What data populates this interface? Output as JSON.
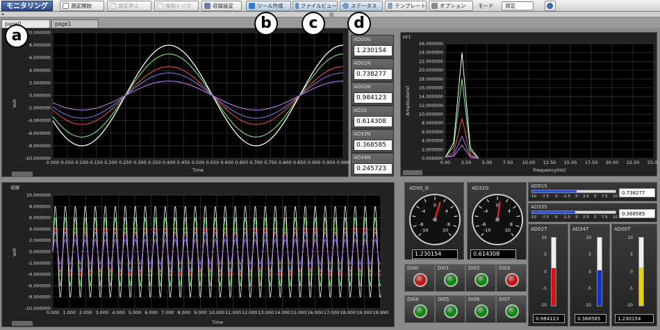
{
  "toolbar": {
    "title": "モニタリング",
    "buttons": [
      {
        "label": "測定開始",
        "icon": "play-icon",
        "enabled": true
      },
      {
        "label": "測定停止",
        "icon": "stop-icon",
        "enabled": false
      },
      {
        "label": "強制トリガ",
        "icon": "trigger-icon",
        "enabled": false
      },
      {
        "label": "収録設定",
        "icon": "settings-icon",
        "enabled": true
      },
      {
        "label": "ツール作成",
        "icon": "plus-icon",
        "enabled": true
      },
      {
        "label": "ファイルビュー",
        "icon": "file-icon",
        "enabled": true
      },
      {
        "label": "ステータス",
        "icon": "search-icon",
        "enabled": true
      },
      {
        "label": "テンプレート",
        "icon": "template-icon",
        "enabled": true
      },
      {
        "label": "オプション",
        "icon": "wrench-icon",
        "enabled": true
      }
    ],
    "mode_label": "モード",
    "mode_value": "測定"
  },
  "tabs": [
    {
      "label": "page0",
      "active": true
    },
    {
      "label": "page1",
      "active": false
    }
  ],
  "callouts": [
    "a",
    "b",
    "c",
    "d"
  ],
  "wave_chart": {
    "ylabel": "Volt",
    "xlabel": "Time",
    "yticks": [
      "10.000000",
      "8.000000",
      "6.000000",
      "4.000000",
      "2.000000",
      "0.000000",
      "-2.000000",
      "-4.000000",
      "-6.000000",
      "-8.000000",
      "-10.000000"
    ],
    "xticks": [
      "0.000",
      "0.050",
      "0.100",
      "0.150",
      "0.200",
      "0.250",
      "0.300",
      "0.350",
      "0.400",
      "0.450",
      "0.500",
      "0.550",
      "0.600",
      "0.650",
      "0.700",
      "0.750",
      "0.800",
      "0.850",
      "0.900",
      "0.950",
      "0.999"
    ]
  },
  "channels": [
    {
      "name": "AD00N",
      "value": "1.230154"
    },
    {
      "name": "AD01N",
      "value": "0.738277"
    },
    {
      "name": "AD02N",
      "value": "0.984123"
    },
    {
      "name": "AD32",
      "value": "0.614308"
    },
    {
      "name": "AD33N",
      "value": "0.368585"
    },
    {
      "name": "AD34N",
      "value": "0.245723"
    }
  ],
  "fft_chart": {
    "title": "FFT",
    "ylabel": "Amplitude(V)",
    "xlabel": "Frequency(Hz)",
    "yticks": [
      "26.000000",
      "24.000000",
      "22.000000",
      "20.000000",
      "18.000000",
      "16.000000",
      "14.000000",
      "12.000000",
      "10.000000",
      "8.000000",
      "6.000000",
      "4.000000",
      "2.000000",
      "0.000000"
    ],
    "xticks": [
      "0.00",
      "2.50",
      "5.00",
      "7.50",
      "10.00",
      "12.50",
      "15.00",
      "17.50",
      "20.00",
      "22.50",
      "25.00"
    ]
  },
  "record_chart": {
    "title": "収録",
    "ylabel": "Volt",
    "xlabel": "Time",
    "yticks": [
      "10.000000",
      "8.000000",
      "6.000000",
      "4.000000",
      "2.000000",
      "0.000000",
      "-2.000000",
      "-4.000000",
      "-6.000000",
      "-8.000000",
      "-10.000000"
    ],
    "xticks": [
      "0.000",
      "1.000",
      "2.000",
      "3.000",
      "4.000",
      "5.000",
      "6.000",
      "7.000",
      "8.000",
      "9.000",
      "10.000",
      "11.000",
      "12.000",
      "13.000",
      "14.000",
      "15.000",
      "16.000",
      "17.000",
      "18.000",
      "19.000",
      "19.990"
    ]
  },
  "gauges": [
    {
      "name": "AD00_G",
      "value": "1.230154",
      "level": 1.230154
    },
    {
      "name": "AD32G",
      "value": "0.614308",
      "level": 0.614308
    }
  ],
  "gauge_scale": [
    "-10",
    "-8",
    "-6",
    "-4",
    "-2",
    "0",
    "2",
    "4",
    "6",
    "8",
    "10"
  ],
  "hbars": [
    {
      "name": "AD01S",
      "value": "0.738277",
      "level": 0.738277
    },
    {
      "name": "AD33S",
      "value": "0.368585",
      "level": 0.368585
    }
  ],
  "hbar_scale": [
    "-10",
    "-7.5",
    "-5",
    "-2.5",
    "0",
    "2.5",
    "5",
    "7.5",
    "10"
  ],
  "dio": [
    {
      "name": "DI00",
      "color": "#c81010"
    },
    {
      "name": "DI01",
      "color": "#0a8a0a"
    },
    {
      "name": "DI02",
      "color": "#0a8a0a"
    },
    {
      "name": "DI03",
      "color": "#c81010"
    },
    {
      "name": "DI04",
      "color": "#0a8a0a"
    },
    {
      "name": "DI05",
      "color": "#0a8a0a"
    },
    {
      "name": "DI06",
      "color": "#0a8a0a"
    },
    {
      "name": "DI07",
      "color": "#0a8a0a"
    }
  ],
  "thermometers": [
    {
      "name": "AD02T",
      "value": "0.984123",
      "level": 0.984123,
      "color": "#e01010"
    },
    {
      "name": "AD34T",
      "value": "0.368585",
      "level": 0.368585,
      "color": "#1030d0"
    },
    {
      "name": "AD00T",
      "value": "1.230154",
      "level": 1.230154,
      "color": "#e8d010"
    }
  ],
  "thermo_scale": [
    "10",
    "5",
    "0",
    "-5",
    "-10"
  ],
  "colors": {
    "series": [
      "#ffffff",
      "#80ff80",
      "#ff5050",
      "#8080ff",
      "#d080ff"
    ]
  }
}
